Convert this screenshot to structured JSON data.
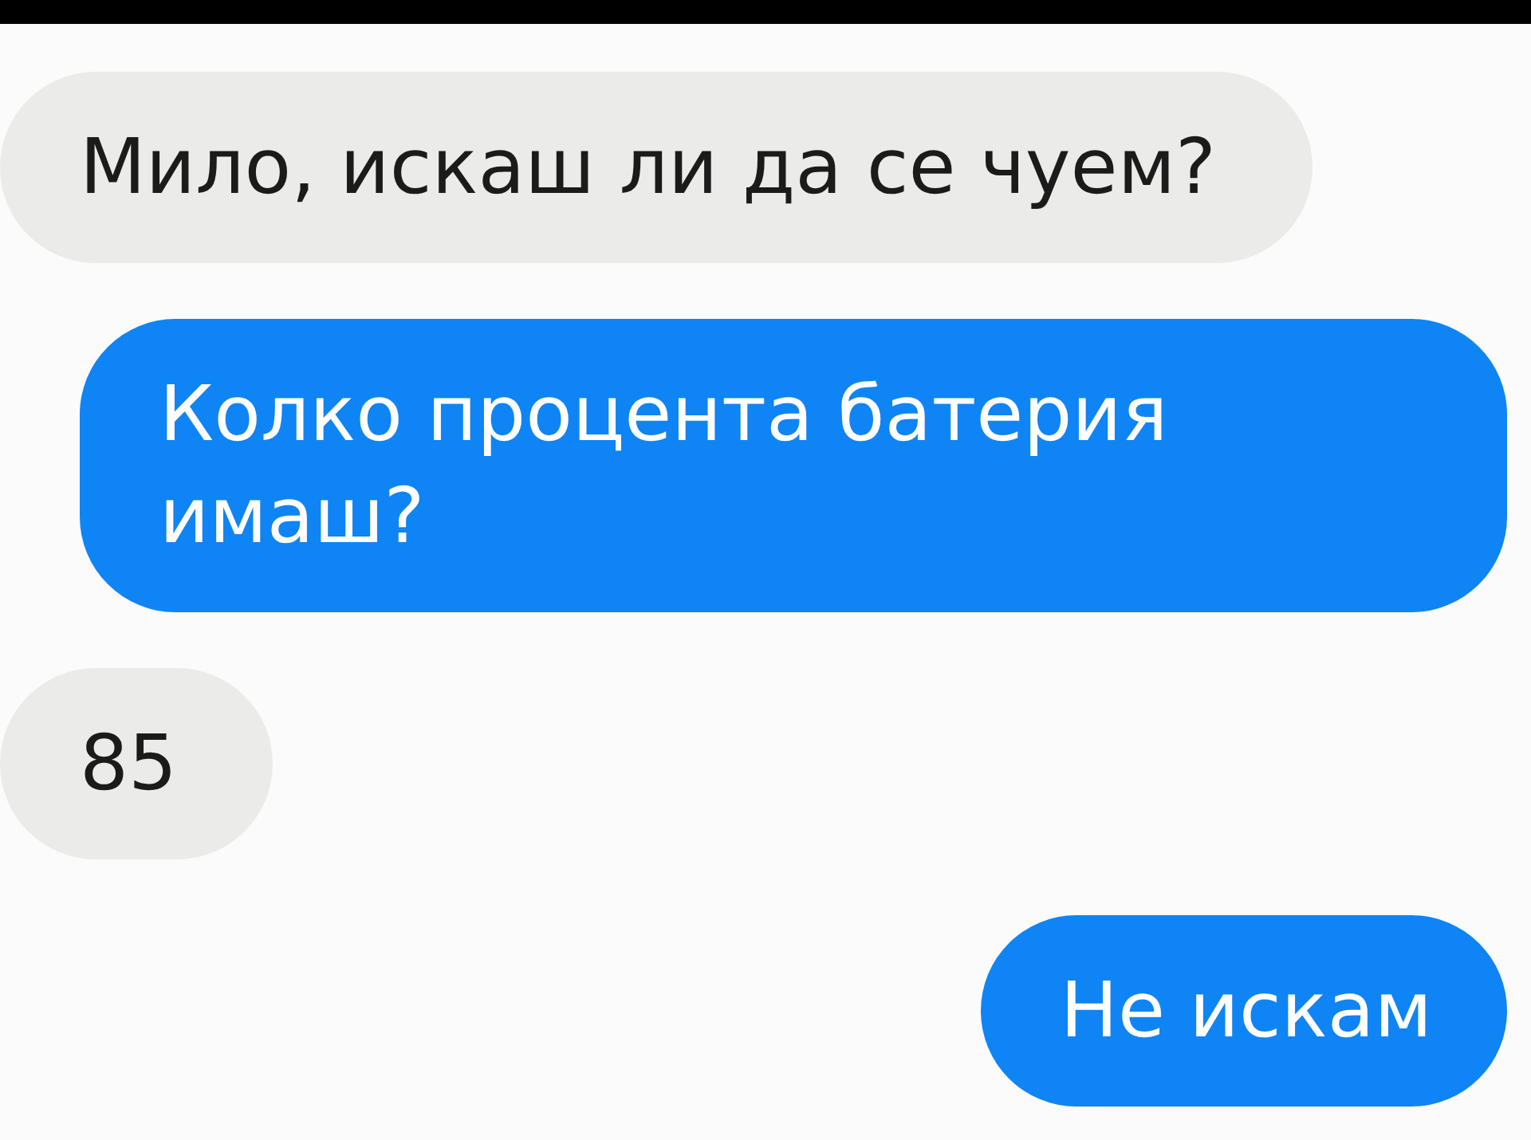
{
  "messages": [
    {
      "kind": "incoming",
      "text": "Мило, искаш ли да се чуем?"
    },
    {
      "kind": "outgoing",
      "text": "Колко процента батерия имаш?"
    },
    {
      "kind": "incoming",
      "text": "85"
    },
    {
      "kind": "outgoing",
      "text": "Не искам"
    }
  ]
}
